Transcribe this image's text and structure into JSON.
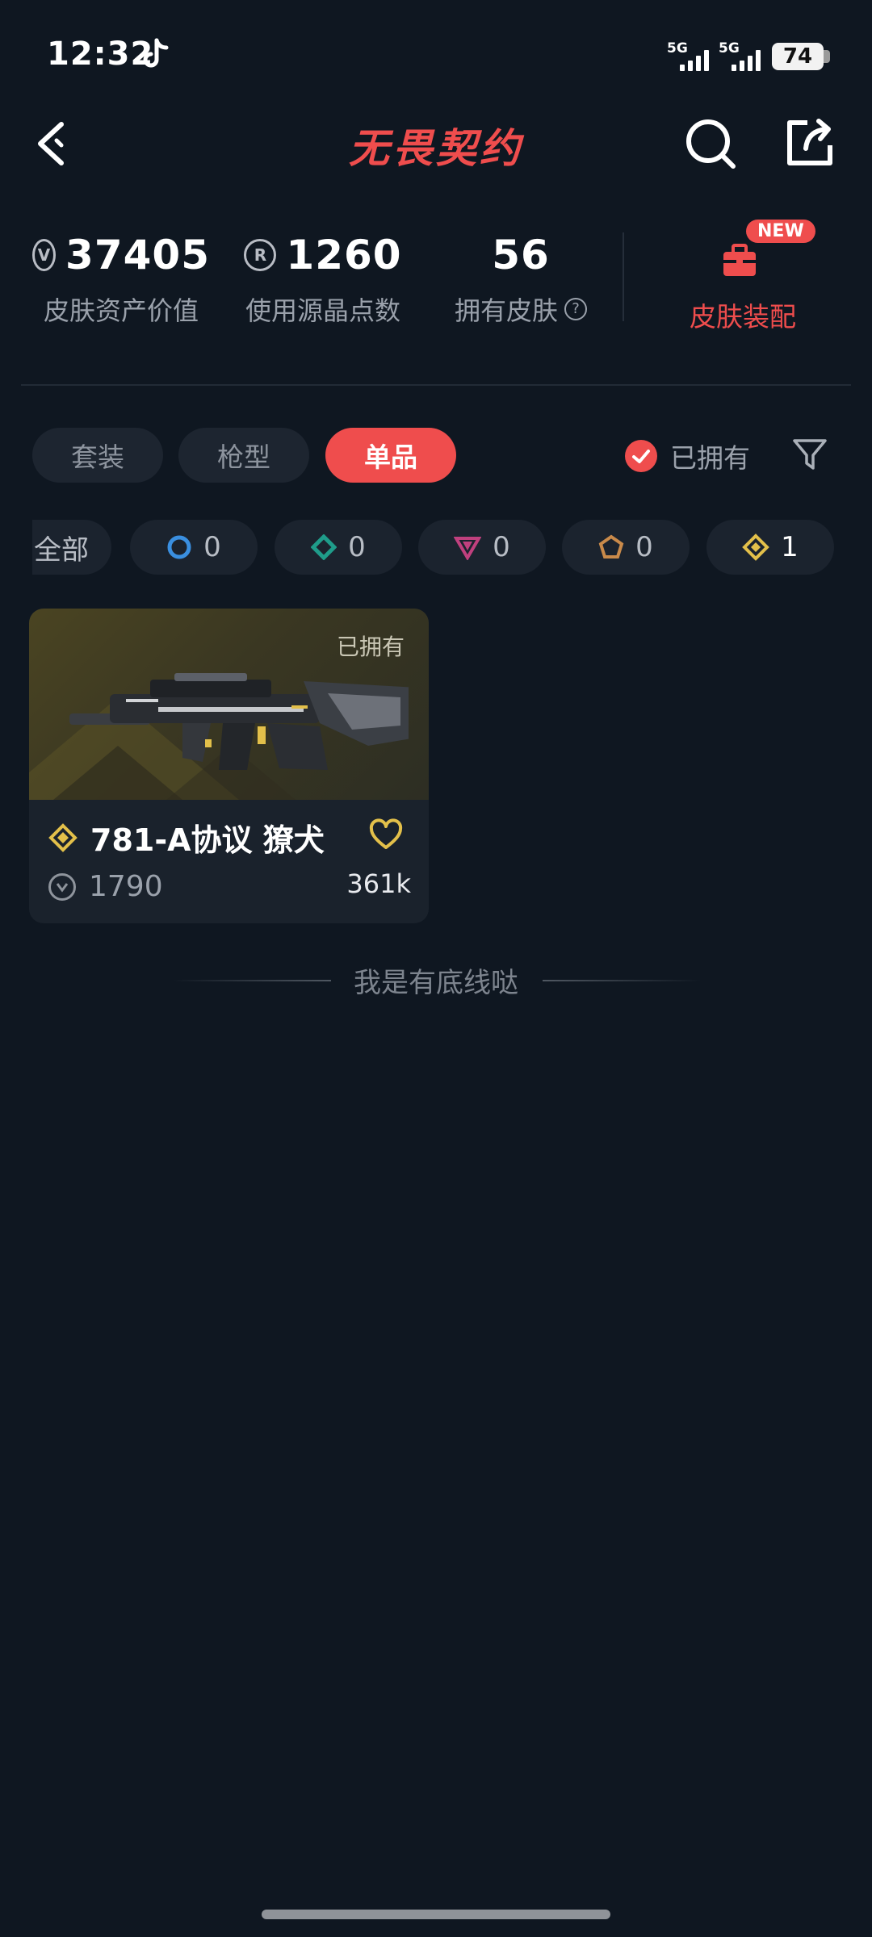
{
  "status_bar": {
    "time": "12:32",
    "signal1": "5G",
    "signal2": "5G",
    "battery": "74"
  },
  "header": {
    "title": "无畏契约"
  },
  "stats": [
    {
      "value": "37405",
      "label": "皮肤资产价值",
      "icon": "vp-coin-icon"
    },
    {
      "value": "1260",
      "label": "使用源晶点数",
      "icon": "radianite-icon"
    },
    {
      "value": "56",
      "label": "拥有皮肤",
      "icon": "help-icon"
    }
  ],
  "loadout": {
    "badge": "NEW",
    "label": "皮肤装配"
  },
  "tabs": [
    {
      "label": "套装",
      "active": false
    },
    {
      "label": "枪型",
      "active": false
    },
    {
      "label": "单品",
      "active": true
    }
  ],
  "owned_filter": {
    "label": "已拥有",
    "checked": true
  },
  "rarity_chips": {
    "all_label": "全部",
    "items": [
      {
        "icon": "select-edition-icon",
        "color": "#3a8fe0",
        "count": "0"
      },
      {
        "icon": "deluxe-edition-icon",
        "color": "#1f9c8a",
        "count": "0"
      },
      {
        "icon": "premium-edition-icon",
        "color": "#c0407e",
        "count": "0"
      },
      {
        "icon": "exclusive-edition-icon",
        "color": "#c98a4a",
        "count": "0"
      },
      {
        "icon": "ultra-edition-icon",
        "color": "#e3c04a",
        "count": "1"
      }
    ]
  },
  "skin_card": {
    "owned_tag": "已拥有",
    "name": "781-A协议 獠犬",
    "price": "1790",
    "likes": "361k"
  },
  "footer_text": "我是有底线哒",
  "colors": {
    "accent": "#ef4d4d",
    "background": "#0f1721",
    "ultra": "#e3c04a"
  }
}
